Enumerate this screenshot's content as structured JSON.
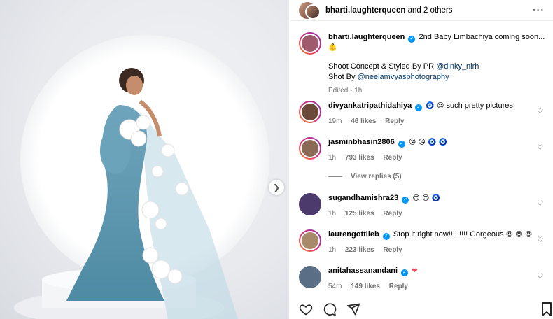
{
  "header": {
    "username": "bharti.laughterqueen",
    "others": "and 2 others",
    "more_icon": "more-icon"
  },
  "caption": {
    "username": "bharti.laughterqueen",
    "text": "2nd Baby Limbachiya coming soon...",
    "emoji": "👶",
    "credit1_prefix": "Shoot Concept & Styled By PR",
    "credit1_handle": "@dinky_nirh",
    "credit2_prefix": "Shot By",
    "credit2_handle": "@neelamvyasphotography",
    "meta": "Edited · 1h"
  },
  "comments": [
    {
      "username": "divyankatripathidahiya",
      "text": "such pretty pictures!",
      "emoji": "🧿 😍",
      "time": "19m",
      "likes": "46 likes",
      "reply": "Reply",
      "avatar_color": "#6b4a3a"
    },
    {
      "username": "jasminbhasin2806",
      "text": "",
      "emoji": "😘 😘 🧿 🧿",
      "time": "1h",
      "likes": "793 likes",
      "reply": "Reply",
      "avatar_color": "#8a6a55"
    },
    {
      "username": "sugandhamishra23",
      "text": "",
      "emoji": "😍 😍 🧿",
      "time": "1h",
      "likes": "125 likes",
      "reply": "Reply",
      "avatar_color": "#4b3a6b"
    },
    {
      "username": "laurengottlieb",
      "text": "Stop it right now!!!!!!!!! Gorgeous",
      "emoji": "😍 😍 😍",
      "time": "1h",
      "likes": "223 likes",
      "reply": "Reply",
      "avatar_color": "#a78a6a"
    },
    {
      "username": "anitahassanandani",
      "text": "",
      "emoji": "❤",
      "time": "54m",
      "likes": "149 likes",
      "reply": "Reply",
      "avatar_color": "#5a6f85"
    }
  ],
  "view_replies": "View replies (5)",
  "colors": {
    "verified": "#0095f6",
    "link": "#00376b",
    "muted": "#737373",
    "dress": "#5e95ad"
  },
  "icons": [
    "heart-icon",
    "comment-icon",
    "share-icon",
    "bookmark-icon",
    "chevron-right-icon"
  ]
}
